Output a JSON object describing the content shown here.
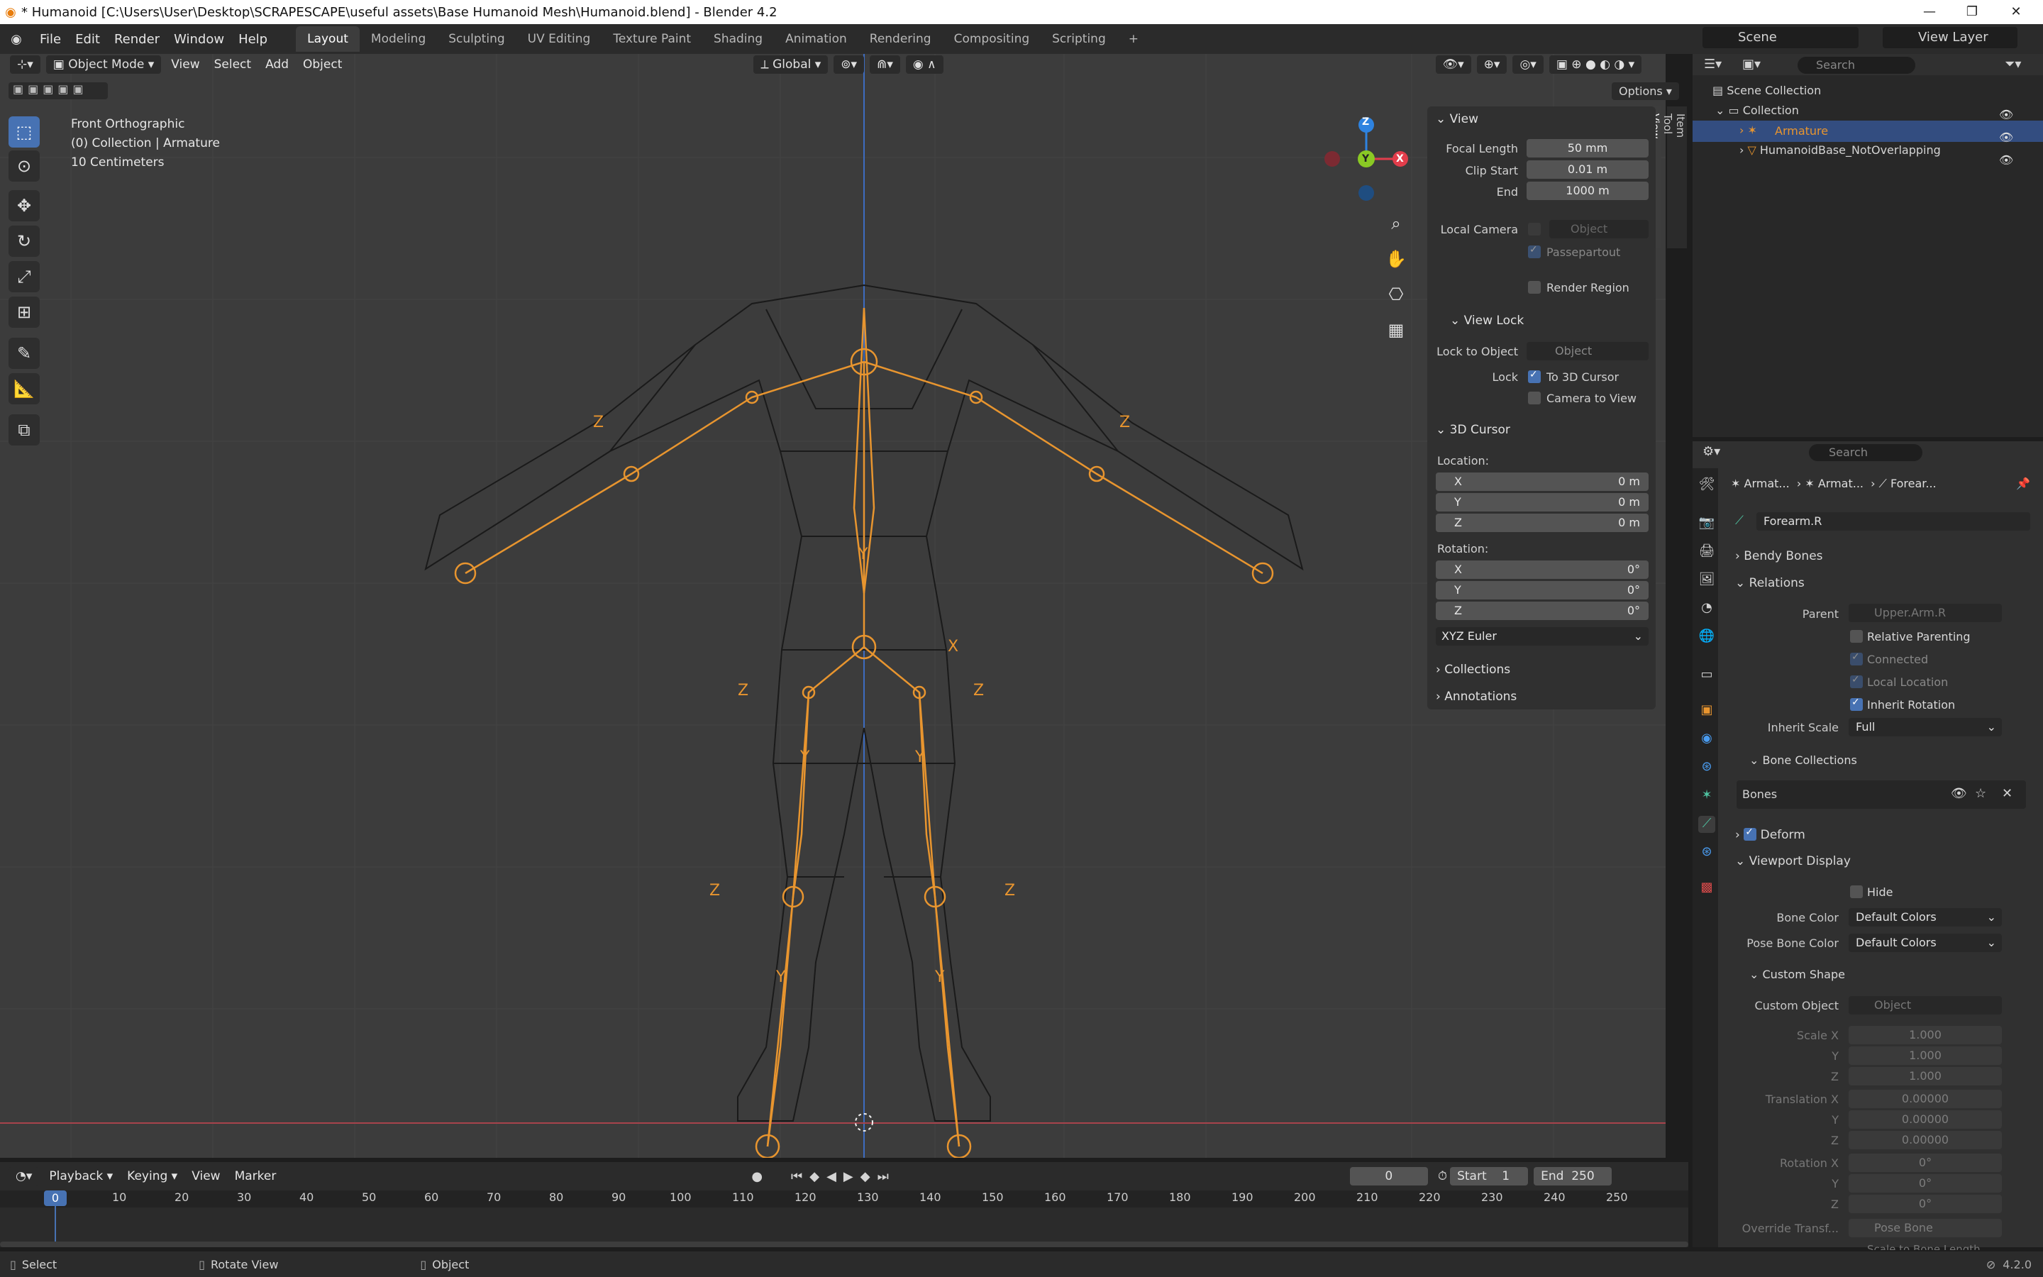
{
  "window": {
    "title": "* Humanoid [C:\\Users\\User\\Desktop\\SCRAPESCAPE\\useful assets\\Base Humanoid Mesh\\Humanoid.blend] - Blender 4.2"
  },
  "menus": [
    "File",
    "Edit",
    "Render",
    "Window",
    "Help"
  ],
  "workspaces": [
    "Layout",
    "Modeling",
    "Sculpting",
    "UV Editing",
    "Texture Paint",
    "Shading",
    "Animation",
    "Rendering",
    "Compositing",
    "Scripting"
  ],
  "scene": {
    "label": "Scene",
    "view_layer": "View Layer"
  },
  "viewport": {
    "mode": "Object Mode",
    "menus": [
      "View",
      "Select",
      "Add",
      "Object"
    ],
    "orientation": "Global",
    "options": "Options",
    "overlay": [
      "Front Orthographic",
      "(0) Collection | Armature",
      "10 Centimeters"
    ],
    "side_tabs": [
      "Item",
      "Tool",
      "View"
    ],
    "gizmo": {
      "x": "X",
      "y": "Y",
      "z": "Z"
    }
  },
  "npanel": {
    "view": {
      "title": "View",
      "focal_length_label": "Focal Length",
      "focal_length": "50 mm",
      "clip_start_label": "Clip Start",
      "clip_start": "0.01 m",
      "end_label": "End",
      "end": "1000 m",
      "local_camera_label": "Local Camera",
      "local_camera_placeholder": "Object",
      "passepartout": "Passepartout",
      "render_region": "Render Region"
    },
    "view_lock": {
      "title": "View Lock",
      "lock_to_object_label": "Lock to Object",
      "lock_to_object_placeholder": "Object",
      "lock_label": "Lock",
      "to_3d_cursor": "To 3D Cursor",
      "camera_to_view": "Camera to View"
    },
    "cursor": {
      "title": "3D Cursor",
      "location_label": "Location:",
      "x_label": "X",
      "x": "0 m",
      "y_label": "Y",
      "y": "0 m",
      "z_label": "Z",
      "z": "0 m",
      "rotation_label": "Rotation:",
      "rx_label": "X",
      "rx": "0°",
      "ry_label": "Y",
      "ry": "0°",
      "rz_label": "Z",
      "rz": "0°",
      "rotation_mode": "XYZ Euler"
    },
    "collections": "Collections",
    "annotations": "Annotations"
  },
  "outliner": {
    "search_placeholder": "Search",
    "scene_collection": "Scene Collection",
    "collection": "Collection",
    "items": [
      "Armature",
      "HumanoidBase_NotOverlapping"
    ]
  },
  "properties": {
    "search_placeholder": "Search",
    "breadcrumb": [
      "Armat...",
      "Armat...",
      "Forear..."
    ],
    "bone_name": "Forearm.R",
    "bendy_bones": "Bendy Bones",
    "relations": {
      "title": "Relations",
      "parent_label": "Parent",
      "parent": "Upper.Arm.R",
      "relative_parenting": "Relative Parenting",
      "connected": "Connected",
      "local_location": "Local Location",
      "inherit_rotation": "Inherit Rotation",
      "inherit_scale_label": "Inherit Scale",
      "inherit_scale": "Full"
    },
    "bone_collections": {
      "title": "Bone Collections",
      "item": "Bones"
    },
    "deform": "Deform",
    "viewport_display": {
      "title": "Viewport Display",
      "hide": "Hide",
      "bone_color_label": "Bone Color",
      "bone_color": "Default Colors",
      "pose_bone_color_label": "Pose Bone Color",
      "pose_bone_color": "Default Colors"
    },
    "custom_shape": {
      "title": "Custom Shape",
      "custom_object_label": "Custom Object",
      "custom_object_placeholder": "Object",
      "scale_x_label": "Scale X",
      "scale_x": "1.000",
      "scale_y_label": "Y",
      "scale_y": "1.000",
      "scale_z_label": "Z",
      "scale_z": "1.000",
      "tx_label": "Translation X",
      "tx": "0.00000",
      "ty_label": "Y",
      "ty": "0.00000",
      "tz_label": "Z",
      "tz": "0.00000",
      "rx_label": "Rotation X",
      "rx": "0°",
      "ry_label": "Y",
      "ry": "0°",
      "rz_label": "Z",
      "rz": "0°",
      "override_label": "Override Transf...",
      "override_placeholder": "Pose Bone",
      "scale_to_bone": "Scale to Bone Length"
    }
  },
  "timeline": {
    "menus": [
      "Playback",
      "Keying",
      "View",
      "Marker"
    ],
    "current_frame": "0",
    "start_label": "Start",
    "start": "1",
    "end_label": "End",
    "end": "250",
    "ticks": [
      "0",
      "10",
      "20",
      "30",
      "40",
      "50",
      "60",
      "70",
      "80",
      "90",
      "100",
      "110",
      "120",
      "130",
      "140",
      "150",
      "160",
      "170",
      "180",
      "190",
      "200",
      "210",
      "220",
      "230",
      "240",
      "250"
    ]
  },
  "status": {
    "select": "Select",
    "rotate_view": "Rotate View",
    "object": "Object",
    "version": "4.2.0"
  },
  "colors": {
    "accent": "#4772b3",
    "bone": "#e8952f",
    "viewport_bg": "#3c3c3c",
    "axis_x": "#e23d4b",
    "axis_y": "#8ac924",
    "axis_z": "#2e83e0"
  }
}
